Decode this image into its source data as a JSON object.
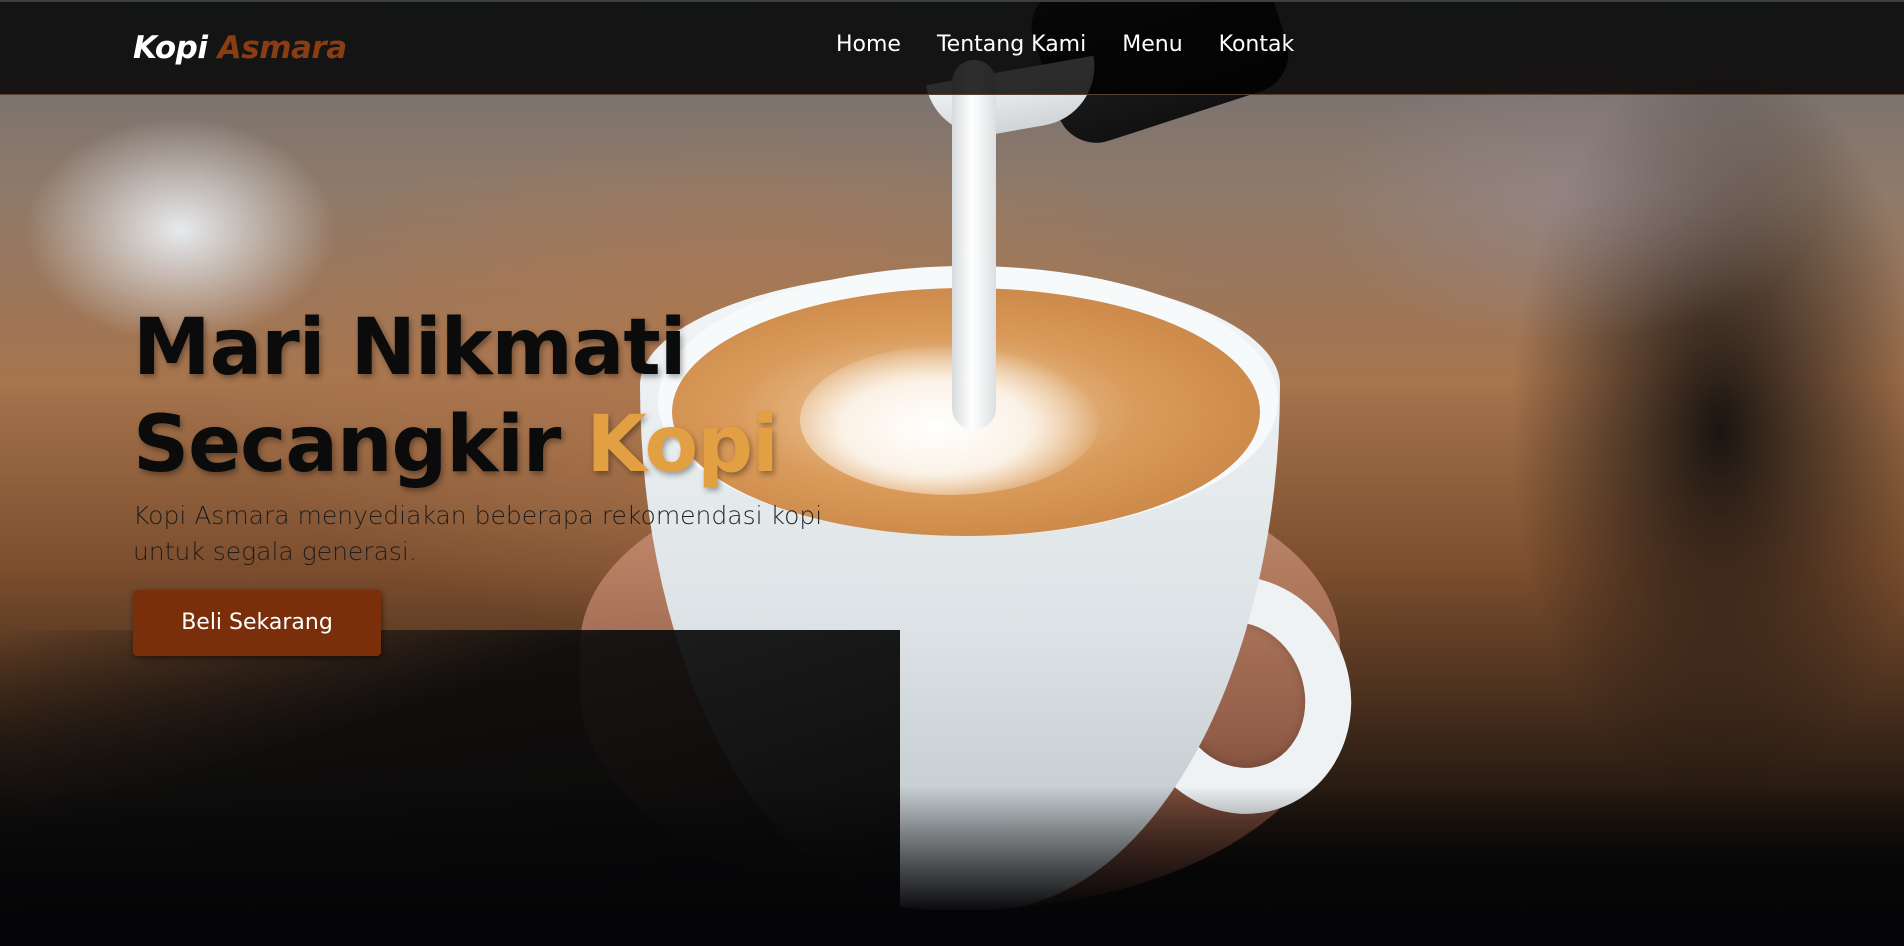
{
  "brand": {
    "name_main": "Kopi",
    "name_accent": "Asmara",
    "accent_color": "#8a3c12"
  },
  "nav": {
    "items": [
      {
        "label": "Home"
      },
      {
        "label": "Tentang Kami"
      },
      {
        "label": "Menu"
      },
      {
        "label": "Kontak"
      }
    ]
  },
  "hero": {
    "headline_line1": "Mari Nikmati",
    "headline_line2_main": "Secangkir",
    "headline_line2_accent": "Kopi",
    "headline_accent_color": "#e3a042",
    "subtext": "Kopi Asmara menyediakan beberapa rekomendasi kopi untuk segala generasi.",
    "cta_label": "Beli Sekarang",
    "cta_color": "#7a2f0a"
  }
}
